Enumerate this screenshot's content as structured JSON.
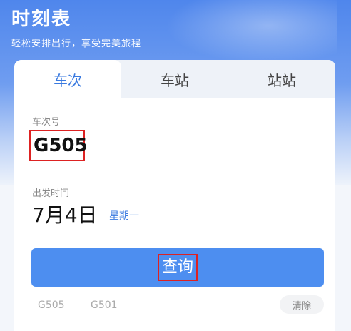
{
  "header": {
    "title": "时刻表",
    "subtitle": "轻松安排出行，享受完美旅程"
  },
  "tabs": [
    {
      "label": "车次",
      "active": true
    },
    {
      "label": "车站",
      "active": false
    },
    {
      "label": "站站",
      "active": false
    }
  ],
  "train_field": {
    "label": "车次号",
    "value": "G505"
  },
  "date_field": {
    "label": "出发时间",
    "date": "7月4日",
    "weekday": "星期一"
  },
  "query_button": {
    "label": "查询"
  },
  "history": {
    "items": [
      "G505",
      "G501"
    ],
    "clear_label": "清除"
  },
  "colors": {
    "accent": "#3a7ae0",
    "button": "#4d8ef0",
    "highlight_box": "#dd2222"
  }
}
